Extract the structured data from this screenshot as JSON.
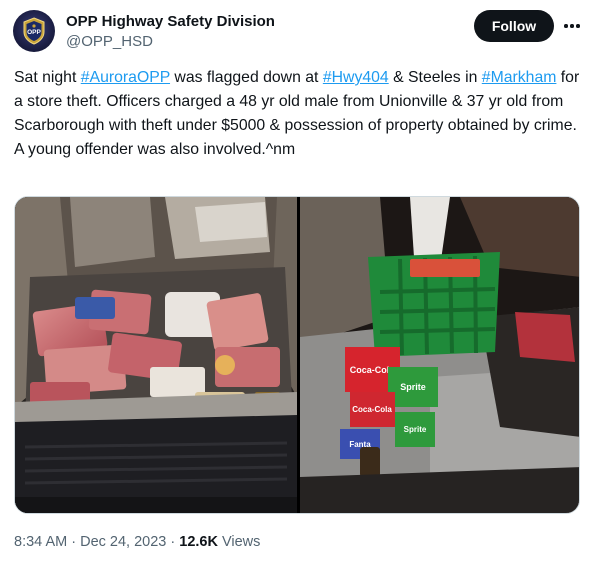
{
  "account": {
    "name": "OPP Highway Safety Division",
    "handle": "@OPP_HSD",
    "avatar_badge_text": "OPP"
  },
  "actions": {
    "follow_label": "Follow",
    "more_icon": "ellipsis-icon"
  },
  "tweet": {
    "segments": [
      {
        "text": "Sat night ",
        "type": "text"
      },
      {
        "text": "#AuroraOPP",
        "type": "hashtag"
      },
      {
        "text": " was flagged down at ",
        "type": "text"
      },
      {
        "text": "#Hwy404",
        "type": "hashtag"
      },
      {
        "text": " & Steeles in ",
        "type": "text"
      },
      {
        "text": "#Markham",
        "type": "hashtag"
      },
      {
        "text": " for a store theft. Officers charged a 48 yr old male from Unionville & 37 yr old from Scarborough with theft under $5000 & possession of property obtained by crime. A young offender was also involved.^nm",
        "type": "text"
      }
    ]
  },
  "media": {
    "photos": [
      {
        "description_icon": "photo-car-trunk-with-stolen-meat"
      },
      {
        "description_icon": "photo-car-backseat-with-soda-and-basket"
      }
    ],
    "can_labels": [
      "Coca-Cola",
      "Sprite",
      "Sprite",
      "Coca-Cola",
      "Fanta"
    ]
  },
  "meta": {
    "time": "8:34 AM",
    "separator": " · ",
    "date": "Dec 24, 2023",
    "views_count": "12.6K",
    "views_label": " Views"
  },
  "colors": {
    "link": "#1d9bf0",
    "text": "#0f1419",
    "muted": "#536471",
    "follow_bg": "#0f1419"
  }
}
